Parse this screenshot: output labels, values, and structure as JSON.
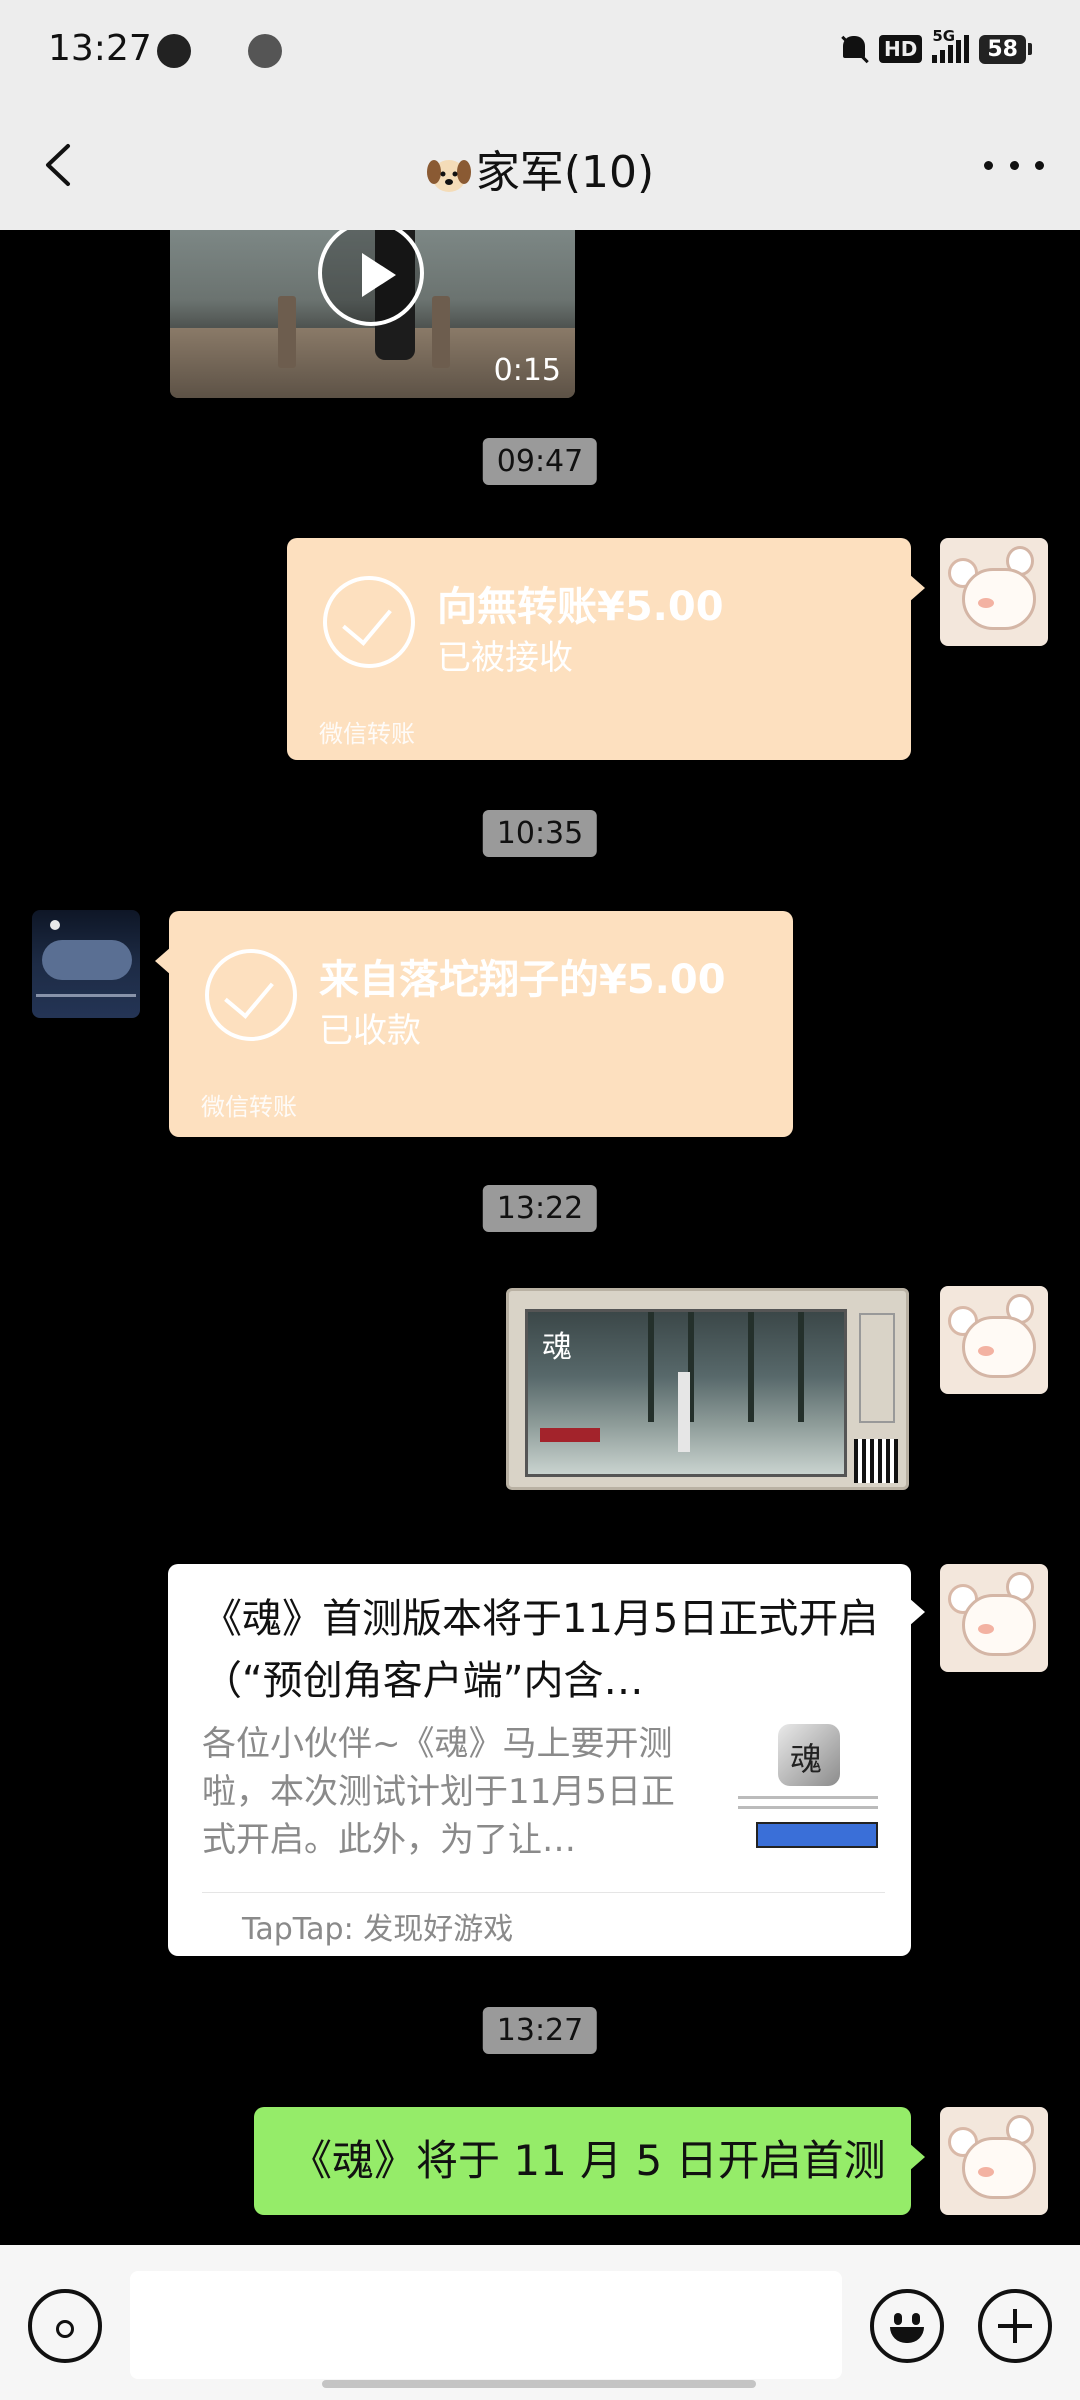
{
  "status_bar": {
    "time": "13:27",
    "network": "5G",
    "hd": "HD",
    "battery": "58"
  },
  "nav": {
    "title": "家军(10)",
    "title_emoji_icon": "dog-face-icon"
  },
  "messages": {
    "video": {
      "duration": "0:15"
    },
    "time1": "09:47",
    "transfer_out": {
      "amount_text": "向無转账¥5.00",
      "status": "已被接收",
      "footer": "微信转账"
    },
    "time2": "10:35",
    "transfer_in": {
      "amount_text": "来自落坨翔子的¥5.00",
      "status": "已收款",
      "footer": "微信转账"
    },
    "time3": "13:22",
    "link_card": {
      "title": "《魂》首测版本将于11月5日正式开启（“预创角客户端”内含…",
      "description": "各位小伙伴~《魂》马上要开测啦，本次测试计划于11月5日正式开启。此外，为了让…",
      "source": "TapTap: 发现好游戏"
    },
    "time4": "13:27",
    "text_message": "《魂》将于 11 月 5 日开启首测"
  },
  "colors": {
    "chat_bg": "#000000",
    "bar_bg": "#ededed",
    "transfer_bubble": "#fde0bf",
    "sent_bubble": "#95ec69",
    "time_pill": "#9a9a9a"
  }
}
